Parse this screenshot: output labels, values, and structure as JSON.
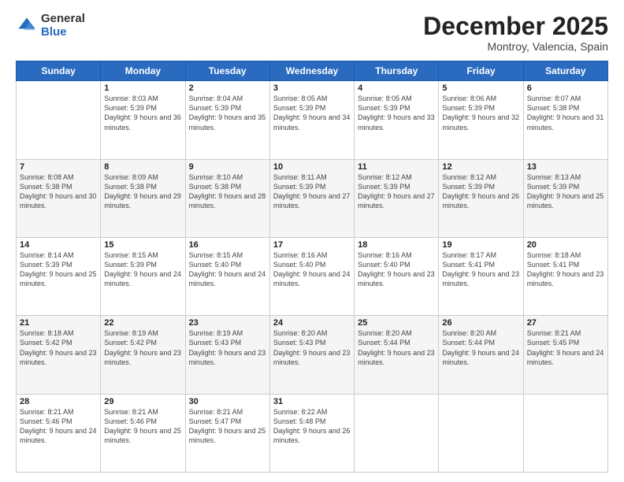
{
  "logo": {
    "general": "General",
    "blue": "Blue"
  },
  "header": {
    "month": "December 2025",
    "location": "Montroy, Valencia, Spain"
  },
  "days_of_week": [
    "Sunday",
    "Monday",
    "Tuesday",
    "Wednesday",
    "Thursday",
    "Friday",
    "Saturday"
  ],
  "weeks": [
    [
      {
        "day": "",
        "sunrise": "",
        "sunset": "",
        "daylight": ""
      },
      {
        "day": "1",
        "sunrise": "8:03 AM",
        "sunset": "5:39 PM",
        "daylight": "9 hours and 36 minutes."
      },
      {
        "day": "2",
        "sunrise": "8:04 AM",
        "sunset": "5:39 PM",
        "daylight": "9 hours and 35 minutes."
      },
      {
        "day": "3",
        "sunrise": "8:05 AM",
        "sunset": "5:39 PM",
        "daylight": "9 hours and 34 minutes."
      },
      {
        "day": "4",
        "sunrise": "8:05 AM",
        "sunset": "5:39 PM",
        "daylight": "9 hours and 33 minutes."
      },
      {
        "day": "5",
        "sunrise": "8:06 AM",
        "sunset": "5:39 PM",
        "daylight": "9 hours and 32 minutes."
      },
      {
        "day": "6",
        "sunrise": "8:07 AM",
        "sunset": "5:38 PM",
        "daylight": "9 hours and 31 minutes."
      }
    ],
    [
      {
        "day": "7",
        "sunrise": "8:08 AM",
        "sunset": "5:38 PM",
        "daylight": "9 hours and 30 minutes."
      },
      {
        "day": "8",
        "sunrise": "8:09 AM",
        "sunset": "5:38 PM",
        "daylight": "9 hours and 29 minutes."
      },
      {
        "day": "9",
        "sunrise": "8:10 AM",
        "sunset": "5:38 PM",
        "daylight": "9 hours and 28 minutes."
      },
      {
        "day": "10",
        "sunrise": "8:11 AM",
        "sunset": "5:39 PM",
        "daylight": "9 hours and 27 minutes."
      },
      {
        "day": "11",
        "sunrise": "8:12 AM",
        "sunset": "5:39 PM",
        "daylight": "9 hours and 27 minutes."
      },
      {
        "day": "12",
        "sunrise": "8:12 AM",
        "sunset": "5:39 PM",
        "daylight": "9 hours and 26 minutes."
      },
      {
        "day": "13",
        "sunrise": "8:13 AM",
        "sunset": "5:39 PM",
        "daylight": "9 hours and 25 minutes."
      }
    ],
    [
      {
        "day": "14",
        "sunrise": "8:14 AM",
        "sunset": "5:39 PM",
        "daylight": "9 hours and 25 minutes."
      },
      {
        "day": "15",
        "sunrise": "8:15 AM",
        "sunset": "5:39 PM",
        "daylight": "9 hours and 24 minutes."
      },
      {
        "day": "16",
        "sunrise": "8:15 AM",
        "sunset": "5:40 PM",
        "daylight": "9 hours and 24 minutes."
      },
      {
        "day": "17",
        "sunrise": "8:16 AM",
        "sunset": "5:40 PM",
        "daylight": "9 hours and 24 minutes."
      },
      {
        "day": "18",
        "sunrise": "8:16 AM",
        "sunset": "5:40 PM",
        "daylight": "9 hours and 23 minutes."
      },
      {
        "day": "19",
        "sunrise": "8:17 AM",
        "sunset": "5:41 PM",
        "daylight": "9 hours and 23 minutes."
      },
      {
        "day": "20",
        "sunrise": "8:18 AM",
        "sunset": "5:41 PM",
        "daylight": "9 hours and 23 minutes."
      }
    ],
    [
      {
        "day": "21",
        "sunrise": "8:18 AM",
        "sunset": "5:42 PM",
        "daylight": "9 hours and 23 minutes."
      },
      {
        "day": "22",
        "sunrise": "8:19 AM",
        "sunset": "5:42 PM",
        "daylight": "9 hours and 23 minutes."
      },
      {
        "day": "23",
        "sunrise": "8:19 AM",
        "sunset": "5:43 PM",
        "daylight": "9 hours and 23 minutes."
      },
      {
        "day": "24",
        "sunrise": "8:20 AM",
        "sunset": "5:43 PM",
        "daylight": "9 hours and 23 minutes."
      },
      {
        "day": "25",
        "sunrise": "8:20 AM",
        "sunset": "5:44 PM",
        "daylight": "9 hours and 23 minutes."
      },
      {
        "day": "26",
        "sunrise": "8:20 AM",
        "sunset": "5:44 PM",
        "daylight": "9 hours and 24 minutes."
      },
      {
        "day": "27",
        "sunrise": "8:21 AM",
        "sunset": "5:45 PM",
        "daylight": "9 hours and 24 minutes."
      }
    ],
    [
      {
        "day": "28",
        "sunrise": "8:21 AM",
        "sunset": "5:46 PM",
        "daylight": "9 hours and 24 minutes."
      },
      {
        "day": "29",
        "sunrise": "8:21 AM",
        "sunset": "5:46 PM",
        "daylight": "9 hours and 25 minutes."
      },
      {
        "day": "30",
        "sunrise": "8:21 AM",
        "sunset": "5:47 PM",
        "daylight": "9 hours and 25 minutes."
      },
      {
        "day": "31",
        "sunrise": "8:22 AM",
        "sunset": "5:48 PM",
        "daylight": "9 hours and 26 minutes."
      },
      {
        "day": "",
        "sunrise": "",
        "sunset": "",
        "daylight": ""
      },
      {
        "day": "",
        "sunrise": "",
        "sunset": "",
        "daylight": ""
      },
      {
        "day": "",
        "sunrise": "",
        "sunset": "",
        "daylight": ""
      }
    ]
  ]
}
